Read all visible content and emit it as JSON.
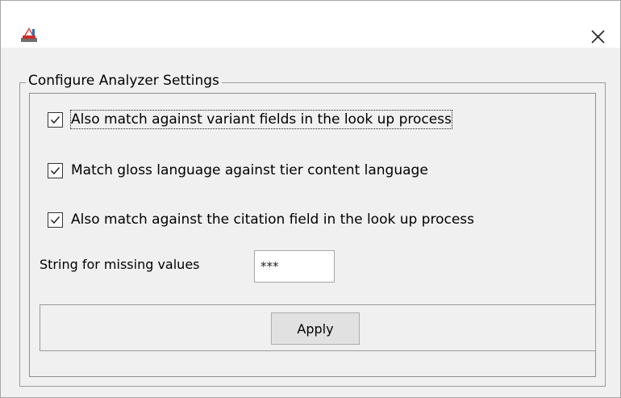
{
  "window": {
    "title": "",
    "app_icon": "app-icon",
    "close_icon": "close-icon",
    "close_glyph": "✕"
  },
  "settings": {
    "group_title": "Configure Analyzer Settings",
    "checkboxes": [
      {
        "label": "Also match against variant fields in the look up process",
        "checked": true,
        "focused": true
      },
      {
        "label": "Match gloss language against tier content language",
        "checked": true,
        "focused": false
      },
      {
        "label": "Also match against the citation field in the look up process",
        "checked": true,
        "focused": false
      }
    ],
    "missing_values": {
      "label": "String for missing values",
      "value": "***"
    },
    "apply_label": "Apply"
  },
  "colors": {
    "content_background": "#f0f0f0",
    "border": "#9c9c9c",
    "button_background": "#e1e1e1"
  }
}
